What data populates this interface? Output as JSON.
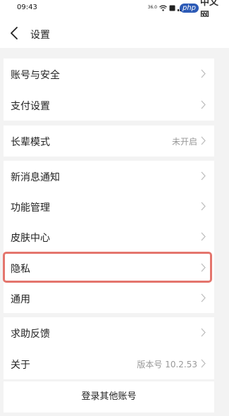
{
  "status_bar": {
    "time": "09:43",
    "signal_text": "36.0",
    "icons": [
      "wifi-icon",
      "sim-icon",
      "signal-icon",
      "battery-icon"
    ]
  },
  "watermark": {
    "badge": "php",
    "text": "中文网"
  },
  "nav": {
    "title": "设置",
    "back_icon": "chevron-left-icon"
  },
  "groups": [
    {
      "items": [
        {
          "label": "账号与安全",
          "value": ""
        },
        {
          "label": "支付设置",
          "value": ""
        }
      ]
    },
    {
      "items": [
        {
          "label": "长辈模式",
          "value": "未开启"
        }
      ]
    },
    {
      "items": [
        {
          "label": "新消息通知",
          "value": ""
        },
        {
          "label": "功能管理",
          "value": ""
        },
        {
          "label": "皮肤中心",
          "value": ""
        },
        {
          "label": "隐私",
          "value": ""
        },
        {
          "label": "通用",
          "value": ""
        }
      ]
    },
    {
      "items": [
        {
          "label": "求助反馈",
          "value": ""
        },
        {
          "label": "关于",
          "value": "版本号 10.2.53"
        }
      ]
    }
  ],
  "footer": {
    "login_other": "登录其他账号"
  },
  "colors": {
    "highlight": "#e4756d",
    "secondary_text": "#999999"
  }
}
